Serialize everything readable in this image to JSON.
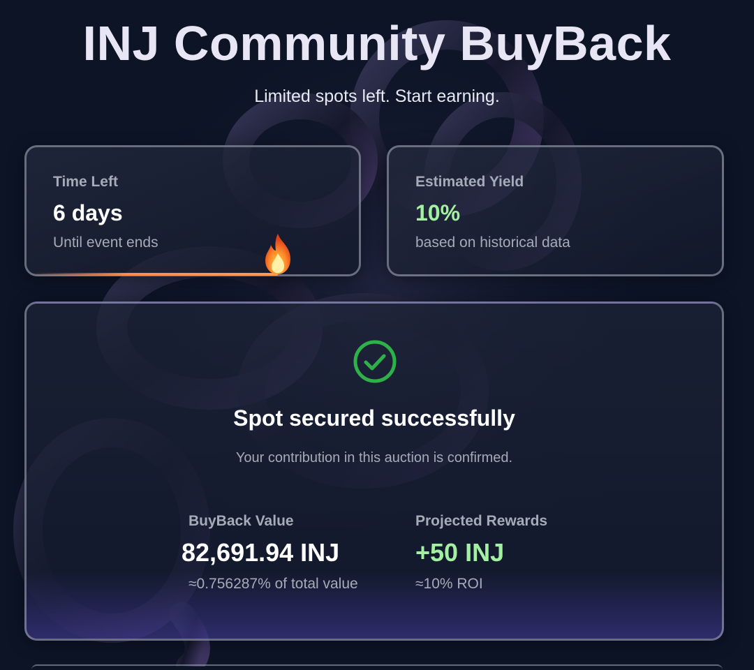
{
  "header": {
    "title": "INJ Community BuyBack",
    "subtitle": "Limited spots left. Start earning."
  },
  "time_card": {
    "label": "Time Left",
    "value": "6 days",
    "note": "Until event ends",
    "progress_fraction": 0.76
  },
  "yield_card": {
    "label": "Estimated Yield",
    "value": "10%",
    "note": "based on historical data"
  },
  "status_card": {
    "title": "Spot secured successfully",
    "message": "Your contribution in this auction is confirmed.",
    "buyback": {
      "label": "BuyBack Value",
      "value": "82,691.94 INJ",
      "note": "≈0.756287% of total value"
    },
    "rewards": {
      "label": "Projected Rewards",
      "value": "+50 INJ",
      "note": "≈10% ROI"
    }
  },
  "icons": {
    "progress": "fire-icon",
    "status": "check-circle-icon"
  },
  "colors": {
    "background": "#0c1426",
    "positive": "#a3f0a2",
    "success": "#2fb14a",
    "muted_text": "#a6abb8",
    "progress": "#ff8a50"
  }
}
